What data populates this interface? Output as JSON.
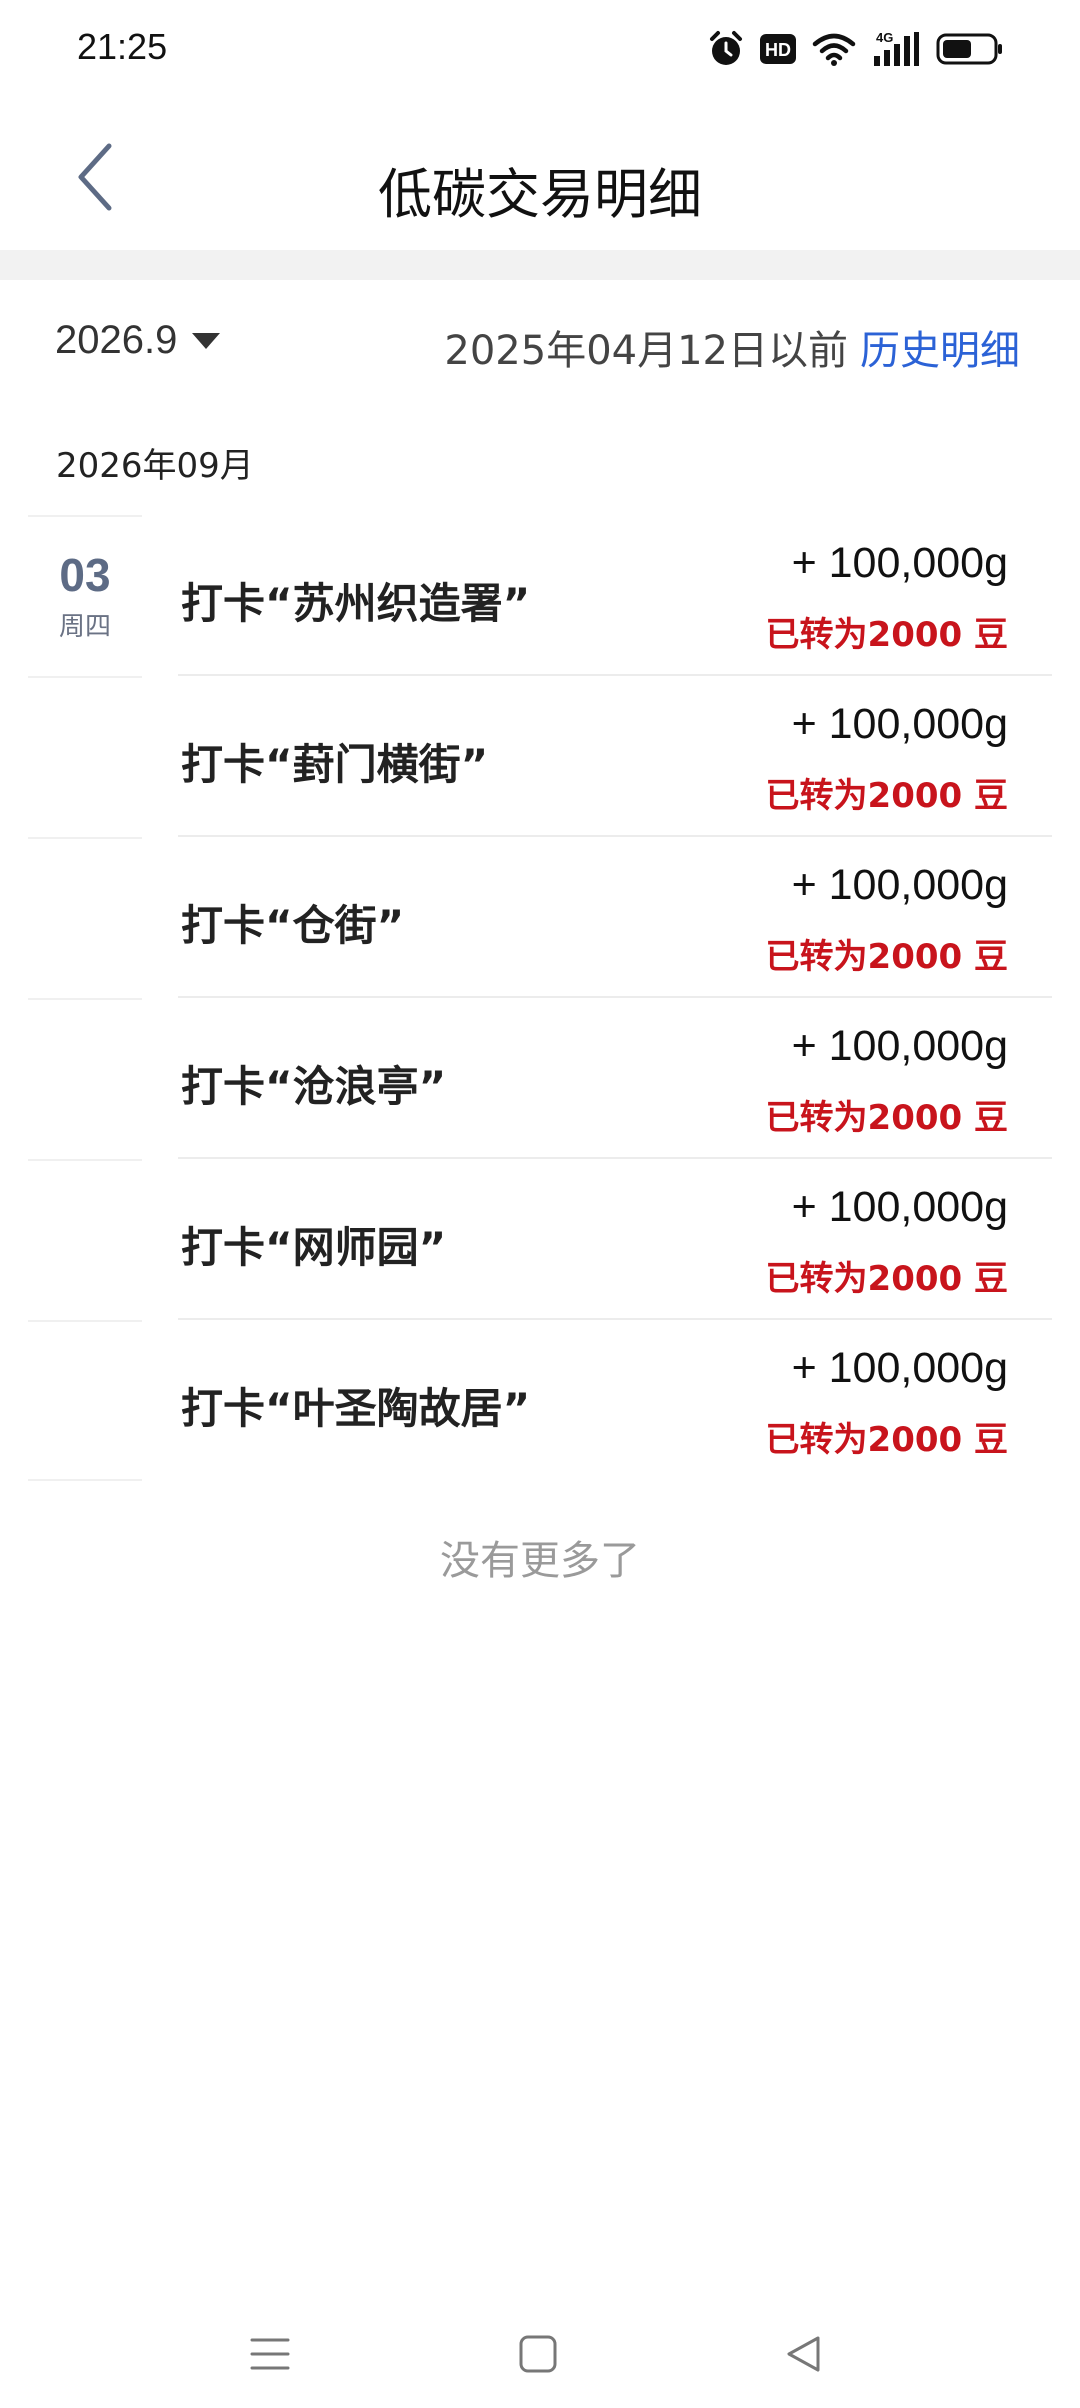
{
  "status_bar": {
    "time": "21:25",
    "icons": [
      "alarm-icon",
      "hd-icon",
      "wifi-icon",
      "signal-4g-icon",
      "battery-icon"
    ],
    "hd_label": "HD",
    "network_label": "4G"
  },
  "header": {
    "title": "低碳交易明细",
    "back_icon": "chevron-left-icon"
  },
  "filter": {
    "month": "2026.9",
    "history_before": "2025年04月12日以前",
    "history_link": "历史明细"
  },
  "section": {
    "month_label": "2026年09月"
  },
  "transactions": [
    {
      "day": "03",
      "weekday": "周四",
      "title": "打卡“苏州织造署”",
      "amount": "+ 100,000g",
      "converted": "已转为2000 豆"
    },
    {
      "day": "",
      "weekday": "",
      "title": "打卡“葑门横街”",
      "amount": "+ 100,000g",
      "converted": "已转为2000 豆"
    },
    {
      "day": "",
      "weekday": "",
      "title": "打卡“仓街”",
      "amount": "+ 100,000g",
      "converted": "已转为2000 豆"
    },
    {
      "day": "",
      "weekday": "",
      "title": "打卡“沧浪亭”",
      "amount": "+ 100,000g",
      "converted": "已转为2000 豆"
    },
    {
      "day": "",
      "weekday": "",
      "title": "打卡“网师园”",
      "amount": "+ 100,000g",
      "converted": "已转为2000 豆"
    },
    {
      "day": "",
      "weekday": "",
      "title": "打卡“叶圣陶故居”",
      "amount": "+ 100,000g",
      "converted": "已转为2000 豆"
    }
  ],
  "footer": {
    "no_more": "没有更多了"
  },
  "nav_bar": {
    "icons": [
      "menu-icon",
      "home-icon",
      "back-icon"
    ]
  },
  "colors": {
    "link": "#2b62d6",
    "converted": "#c8141c",
    "date_day": "#5d6b85",
    "muted": "#9a9a9a"
  }
}
